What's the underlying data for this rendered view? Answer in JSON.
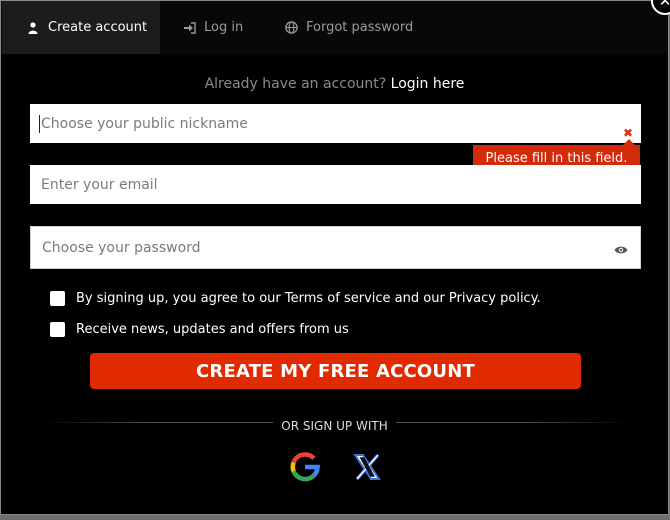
{
  "tabs": [
    {
      "label": "Create account",
      "icon": "user-icon",
      "active": true
    },
    {
      "label": "Log in",
      "icon": "login-icon",
      "active": false
    },
    {
      "label": "Forgot password",
      "icon": "globe-icon",
      "active": false
    }
  ],
  "close": {
    "icon": "close-icon"
  },
  "already": {
    "text": "Already have an account?",
    "link": "Login here"
  },
  "fields": {
    "nickname_placeholder": "Choose your public nickname",
    "email_placeholder": "Enter your email",
    "password_placeholder": "Choose your password"
  },
  "validation": {
    "message": "Please fill in this field."
  },
  "checks": {
    "terms": "By signing up, you agree to our Terms of service and our Privacy policy.",
    "news": "Receive news, updates and offers from us"
  },
  "cta": {
    "label": "CREATE MY FREE ACCOUNT"
  },
  "social": {
    "divider": "OR SIGN UP WITH",
    "google_icon": "google-icon",
    "x_icon": "x-icon"
  },
  "colors": {
    "accent": "#e02a00",
    "error": "#d42a0c"
  }
}
